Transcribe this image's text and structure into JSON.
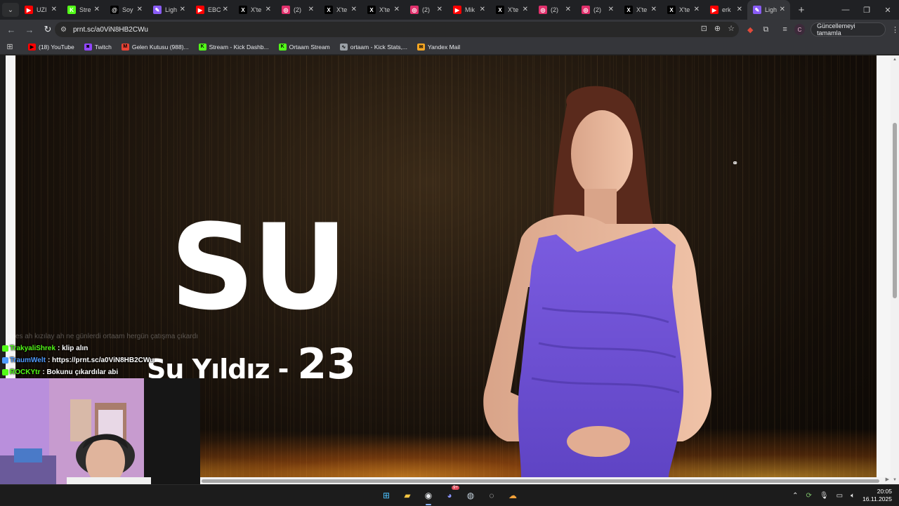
{
  "browser": {
    "tabs": [
      {
        "title": "UZI",
        "icon": "youtube-icon",
        "color": "#ff0000"
      },
      {
        "title": "Stre",
        "icon": "kick-icon",
        "color": "#53fc18"
      },
      {
        "title": "Soy",
        "icon": "threads-icon",
        "color": "#000000"
      },
      {
        "title": "Ligh",
        "icon": "lightshot-icon",
        "color": "#8a5cf6"
      },
      {
        "title": "EBC",
        "icon": "youtube-icon",
        "color": "#ff0000"
      },
      {
        "title": "X'te",
        "icon": "x-icon",
        "color": "#000000"
      },
      {
        "title": "(2)",
        "icon": "instagram-icon",
        "color": "#e1306c"
      },
      {
        "title": "X'te",
        "icon": "x-icon",
        "color": "#000000"
      },
      {
        "title": "X'te",
        "icon": "x-icon",
        "color": "#000000"
      },
      {
        "title": "(2)",
        "icon": "instagram-icon",
        "color": "#e1306c"
      },
      {
        "title": "Mik",
        "icon": "youtube-icon",
        "color": "#ff0000"
      },
      {
        "title": "X'te",
        "icon": "x-icon",
        "color": "#000000"
      },
      {
        "title": "(2)",
        "icon": "instagram-icon",
        "color": "#e1306c"
      },
      {
        "title": "(2)",
        "icon": "instagram-icon",
        "color": "#e1306c"
      },
      {
        "title": "X'te",
        "icon": "x-icon",
        "color": "#000000"
      },
      {
        "title": "X'te",
        "icon": "x-icon",
        "color": "#000000"
      },
      {
        "title": "erk",
        "icon": "youtube-icon",
        "color": "#ff0000"
      },
      {
        "title": "Ligh",
        "icon": "lightshot-icon",
        "color": "#8a5cf6",
        "active": true
      }
    ],
    "url": "prnt.sc/a0ViN8HB2CWu",
    "update_button": "Güncellemeyi tamamla",
    "profile_initial": "C",
    "bookmarks": [
      {
        "label": "(18) YouTube",
        "icon": "youtube-icon",
        "color": "#ff0000"
      },
      {
        "label": "Twitch",
        "icon": "twitch-icon",
        "color": "#9146ff"
      },
      {
        "label": "Gelen Kutusu (988)...",
        "icon": "gmail-icon",
        "color": "#ea4335"
      },
      {
        "label": "Stream - Kick Dashb...",
        "icon": "kick-icon",
        "color": "#53fc18"
      },
      {
        "label": "Ortaam Stream",
        "icon": "kick-icon",
        "color": "#53fc18"
      },
      {
        "label": "ortaam - Kick Stats,...",
        "icon": "kickstats-icon",
        "color": "#9aa0a6"
      },
      {
        "label": "Yandex Mail",
        "icon": "mail-icon",
        "color": "#f5a623"
      }
    ]
  },
  "video": {
    "big_title": "SU",
    "contestant_name": "Su Yıldız",
    "dash": "-",
    "number": "23"
  },
  "chat": [
    {
      "user": "",
      "message": "abtes ah kızılay ah ne günlerdi ortaam hergün çatışma çıkardı",
      "faded": true
    },
    {
      "user": "TrakyaliShrek",
      "user_color": "#53fc18",
      "message": ": klip alın"
    },
    {
      "user": "TraumWelt",
      "user_color": "#4f9bff",
      "message": ": https://prnt.sc/a0ViN8HB2CWu"
    },
    {
      "user": "ROCKYtr",
      "user_color": "#53fc18",
      "message": ": Bokunu çıkardılar abi"
    }
  ],
  "taskbar": {
    "apps": [
      {
        "icon": "windows-start-icon"
      },
      {
        "icon": "file-explorer-icon"
      },
      {
        "icon": "chrome-icon",
        "active": true
      },
      {
        "icon": "discord-icon",
        "badge": "9+"
      },
      {
        "icon": "steam-icon"
      },
      {
        "icon": "obs-icon"
      },
      {
        "icon": "cloud-app-icon"
      }
    ],
    "time": "20:05",
    "date": "16.11.2025"
  }
}
